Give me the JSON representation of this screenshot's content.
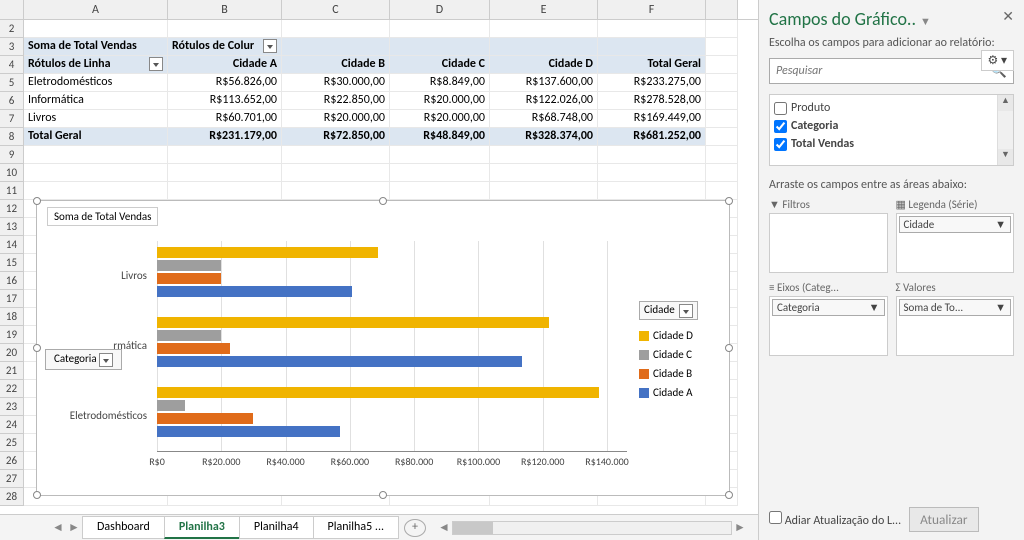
{
  "columns": [
    "A",
    "B",
    "C",
    "D",
    "E",
    "F"
  ],
  "pivot": {
    "measure_label": "Soma de Total Vendas",
    "col_label": "Rótulos de Colur",
    "row_label": "Rótulos de Linha",
    "col_headers": [
      "Cidade A",
      "Cidade B",
      "Cidade C",
      "Cidade D",
      "Total Geral"
    ],
    "rows": [
      {
        "label": "Eletrodomésticos",
        "vals": [
          "R$56.826,00",
          "R$30.000,00",
          "R$8.849,00",
          "R$137.600,00",
          "R$233.275,00"
        ]
      },
      {
        "label": "Informática",
        "vals": [
          "R$113.652,00",
          "R$22.850,00",
          "R$20.000,00",
          "R$122.026,00",
          "R$278.528,00"
        ]
      },
      {
        "label": "Livros",
        "vals": [
          "R$60.701,00",
          "R$20.000,00",
          "R$20.000,00",
          "R$68.748,00",
          "R$169.449,00"
        ]
      }
    ],
    "total": {
      "label": "Total Geral",
      "vals": [
        "R$231.179,00",
        "R$72.850,00",
        "R$48.849,00",
        "R$328.374,00",
        "R$681.252,00"
      ]
    }
  },
  "chart": {
    "title": "Soma de Total Vendas",
    "axis_button": "Categoria",
    "legend_button": "Cidade",
    "legend": [
      "Cidade D",
      "Cidade C",
      "Cidade B",
      "Cidade A"
    ],
    "x_ticks": [
      "R$0",
      "R$20.000",
      "R$40.000",
      "R$60.000",
      "R$80.000",
      "R$100.000",
      "R$120.000",
      "R$140.000"
    ],
    "categories": [
      "Livros",
      "rmática",
      "Eletrodomésticos"
    ],
    "colors": {
      "Cidade A": "#4472c4",
      "Cidade B": "#e06b1a",
      "Cidade C": "#9e9e9e",
      "Cidade D": "#f0b400"
    }
  },
  "chart_data": {
    "type": "bar",
    "orientation": "horizontal",
    "title": "Soma de Total Vendas",
    "xlabel": "",
    "ylabel": "Categoria",
    "xlim": [
      0,
      140000
    ],
    "categories": [
      "Livros",
      "Informática",
      "Eletrodomésticos"
    ],
    "series": [
      {
        "name": "Cidade D",
        "values": [
          68748,
          122026,
          137600
        ]
      },
      {
        "name": "Cidade C",
        "values": [
          20000,
          20000,
          8849
        ]
      },
      {
        "name": "Cidade B",
        "values": [
          20000,
          22850,
          30000
        ]
      },
      {
        "name": "Cidade A",
        "values": [
          60701,
          113652,
          56826
        ]
      }
    ]
  },
  "tabs": {
    "items": [
      "Dashboard",
      "Planilha3",
      "Planilha4",
      "Planilha5 ..."
    ],
    "active": "Planilha3"
  },
  "pane": {
    "title": "Campos do Gráfico..",
    "subtitle": "Escolha os campos para adicionar ao relatório:",
    "search_placeholder": "Pesquisar",
    "fields": [
      {
        "label": "Produto",
        "checked": false
      },
      {
        "label": "Categoria",
        "checked": true
      },
      {
        "label": "Total Vendas",
        "checked": true
      }
    ],
    "areas_hint": "Arraste os campos entre as áreas abaixo:",
    "areas": {
      "filters": {
        "title": "Filtros",
        "items": []
      },
      "legend": {
        "title": "Legenda (Série)",
        "items": [
          "Cidade"
        ]
      },
      "axis": {
        "title": "Eixos (Categ...",
        "items": [
          "Categoria"
        ]
      },
      "values": {
        "title": "Valores",
        "items": [
          "Soma de To..."
        ]
      }
    },
    "defer_label": "Adiar Atualização do L...",
    "update_btn": "Atualizar"
  }
}
